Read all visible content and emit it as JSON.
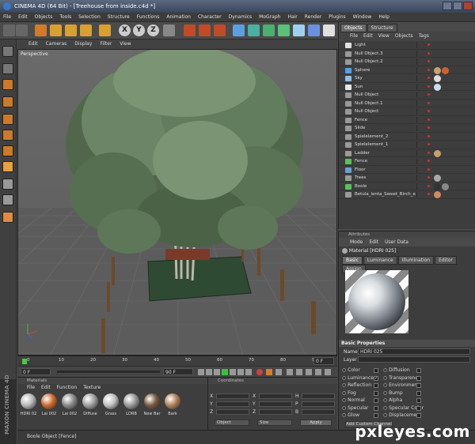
{
  "window": {
    "title": "CINEMA 4D (64 Bit) - [Treehouse from inside.c4d *]"
  },
  "menubar": [
    "File",
    "Edit",
    "Objects",
    "Tools",
    "Selection",
    "Structure",
    "Functions",
    "Animation",
    "Character",
    "Dynamics",
    "MoGraph",
    "Hair",
    "Render",
    "Plugins",
    "Window",
    "Help"
  ],
  "toolbar": {
    "axis_x": "X",
    "axis_y": "Y",
    "axis_z": "Z"
  },
  "viewport": {
    "menu": [
      "Edit",
      "Cameras",
      "Display",
      "Filter",
      "View"
    ],
    "label": "Perspective"
  },
  "timeline": {
    "ticks": [
      "0",
      "10",
      "20",
      "30",
      "40",
      "50",
      "60",
      "70",
      "80",
      "90"
    ],
    "current_frame": "0 F"
  },
  "playbar": {
    "start": "0 F",
    "end": "90 F"
  },
  "object_manager": {
    "tabs": [
      "Objects",
      "Structure"
    ],
    "menu": [
      "File",
      "Edit",
      "View",
      "Objects",
      "Tags"
    ],
    "objects": [
      {
        "name": "Light",
        "icon": "light-icon",
        "color": "#e0e0e0"
      },
      {
        "name": "Null Object.3",
        "icon": "null-icon",
        "color": "#9a9a9a"
      },
      {
        "name": "Null Object.2",
        "icon": "null-icon",
        "color": "#9a9a9a"
      },
      {
        "name": "Sphere",
        "icon": "sphere-icon",
        "color": "#5aa0e0"
      },
      {
        "name": "Sky",
        "icon": "sky-icon",
        "color": "#8fc0e8"
      },
      {
        "name": "Sun",
        "icon": "sun-icon",
        "color": "#e8e8e8"
      },
      {
        "name": "Null Object",
        "icon": "null-icon",
        "color": "#9a9a9a"
      },
      {
        "name": "Null Object.1",
        "icon": "null-icon",
        "color": "#9a9a9a"
      },
      {
        "name": "Null Object",
        "icon": "null-icon",
        "color": "#9a9a9a"
      },
      {
        "name": "Fence",
        "icon": "null-icon",
        "color": "#9a9a9a"
      },
      {
        "name": "Slide",
        "icon": "null-icon",
        "color": "#9a9a9a"
      },
      {
        "name": "Spielelement_2",
        "icon": "null-icon",
        "color": "#9a9a9a"
      },
      {
        "name": "Spielelement_1",
        "icon": "null-icon",
        "color": "#9a9a9a"
      },
      {
        "name": "Ladder",
        "icon": "null-icon",
        "color": "#9a9a9a"
      },
      {
        "name": "Fence",
        "icon": "boole-icon",
        "color": "#5ac05a"
      },
      {
        "name": "Floor",
        "icon": "floor-icon",
        "color": "#6aa0d8"
      },
      {
        "name": "Trees",
        "icon": "null-icon",
        "color": "#9a9a9a"
      },
      {
        "name": "Boole",
        "icon": "boole-icon",
        "color": "#5ac05a"
      },
      {
        "name": "Betula_lenta_Sweet_Birch_e",
        "icon": "null-icon",
        "color": "#9a9a9a"
      }
    ]
  },
  "attribute_manager": {
    "header": "Attributes",
    "menu": [
      "Mode",
      "Edit",
      "User Data"
    ],
    "material_label": "Material [HDRI 025]",
    "tabs": [
      "Basic",
      "Luminance",
      "Illumination",
      "Editor",
      "Assign"
    ],
    "section": "Basic Properties",
    "name_label": "Name",
    "name_value": "HDRI 025",
    "layer_label": "Layer",
    "channels_left": [
      {
        "label": "Color",
        "checked": false
      },
      {
        "label": "Luminance",
        "checked": true
      },
      {
        "label": "Reflection",
        "checked": false
      },
      {
        "label": "Fog",
        "checked": false
      },
      {
        "label": "Normal",
        "checked": false
      },
      {
        "label": "Specular",
        "checked": false
      },
      {
        "label": "Glow",
        "checked": false
      }
    ],
    "channels_right": [
      {
        "label": "Diffusion",
        "checked": false
      },
      {
        "label": "Transparency",
        "checked": false
      },
      {
        "label": "Environment",
        "checked": false
      },
      {
        "label": "Bump",
        "checked": false
      },
      {
        "label": "Alpha",
        "checked": false
      },
      {
        "label": "Specular Color",
        "checked": false
      },
      {
        "label": "Displacement",
        "checked": false
      }
    ],
    "add_channel_button": "Add Custom Channel"
  },
  "material_manager": {
    "header": "Materials",
    "menu": [
      "File",
      "Edit",
      "Function",
      "Texture"
    ],
    "materials": [
      {
        "name": "HDRI 02",
        "color": "#b8b8b8"
      },
      {
        "name": "Lai 002",
        "color": "#d06a2a"
      },
      {
        "name": "Lai 002",
        "color": "#8a8a8a"
      },
      {
        "name": "Diffuse",
        "color": "#a0a0a0"
      },
      {
        "name": "Grass",
        "color": "#c0c0c0"
      },
      {
        "name": "LDRB",
        "color": "#9a9a9a"
      },
      {
        "name": "New Bar",
        "color": "#7a5a40"
      },
      {
        "name": "Bark",
        "color": "#b0805a"
      }
    ]
  },
  "coordinates": {
    "header": "Coordinates",
    "col1": [
      "X",
      "Y",
      "Z"
    ],
    "col2": [
      "X",
      "Y",
      "Z"
    ],
    "col3": [
      "H",
      "P",
      "B"
    ],
    "mode": "Object",
    "size_mode": "Size",
    "apply_button": "Apply"
  },
  "statusbar": {
    "text": "Boole Object [Fence]"
  },
  "branding": {
    "vertical": "MAXON CINEMA 4D"
  },
  "watermark": "pxleyes.com"
}
